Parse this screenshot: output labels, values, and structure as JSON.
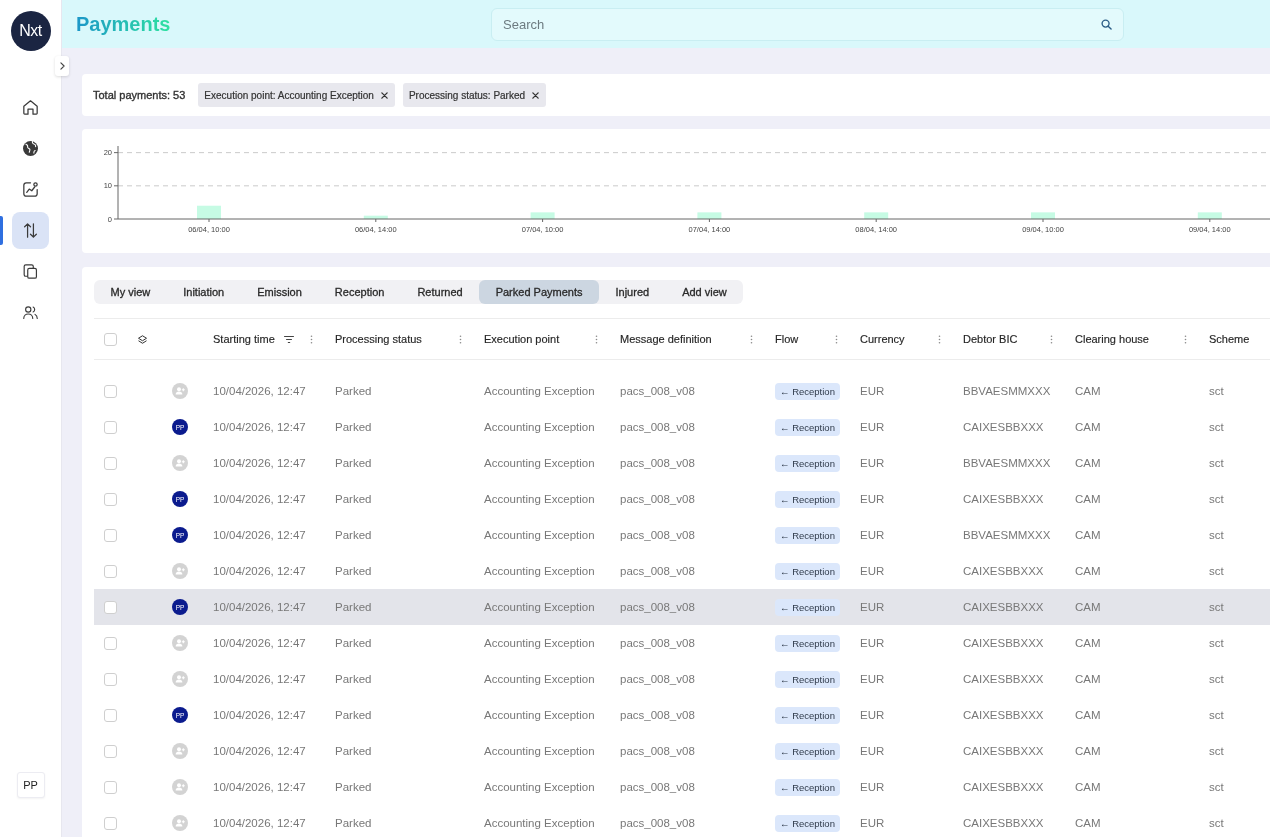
{
  "sidebar": {
    "logo": "Nxt",
    "items": [
      {
        "selected": false
      },
      {
        "selected": false
      },
      {
        "selected": false
      },
      {
        "selected": true
      },
      {
        "selected": false
      },
      {
        "selected": false
      }
    ],
    "user": "PP"
  },
  "top_bar": {
    "title": "Payments",
    "search": {
      "placeholder": "Search"
    }
  },
  "filters": {
    "total": "Total payments: 53",
    "chips": [
      {
        "label": "Execution point: Accounting Exception"
      },
      {
        "label": "Processing status: Parked"
      }
    ]
  },
  "chart": {
    "chart_data": {
      "type": "bar",
      "categories": [
        "06/04, 10:00",
        "06/04, 14:00",
        "07/04, 10:00",
        "07/04, 14:00",
        "08/04, 14:00",
        "09/04, 10:00",
        "09/04, 14:00"
      ],
      "values": [
        4,
        1,
        2,
        2,
        2,
        2,
        2
      ],
      "ylim": [
        0,
        22
      ],
      "yticks": [
        0,
        10,
        20
      ]
    }
  },
  "views": {
    "tabs": [
      {
        "label": "My view",
        "selected": false
      },
      {
        "label": "Initiation",
        "selected": false
      },
      {
        "label": "Emission",
        "selected": false
      },
      {
        "label": "Reception",
        "selected": false
      },
      {
        "label": "Returned",
        "selected": false
      },
      {
        "label": "Parked Payments",
        "selected": true
      },
      {
        "label": "Injured",
        "selected": false
      },
      {
        "label": "Add view",
        "selected": false
      }
    ]
  },
  "table": {
    "select_all": {
      "checked": false
    },
    "columns": [
      {
        "label": "Starting time",
        "filter": true,
        "menu": true
      },
      {
        "label": "Processing status",
        "filter": false,
        "menu": true
      },
      {
        "label": "Execution point",
        "filter": false,
        "menu": true
      },
      {
        "label": "Message definition",
        "filter": false,
        "menu": true
      },
      {
        "label": "Flow",
        "filter": false,
        "menu": true
      },
      {
        "label": "Currency",
        "filter": false,
        "menu": true
      },
      {
        "label": "Debtor BIC",
        "filter": false,
        "menu": true
      },
      {
        "label": "Clearing house",
        "filter": false,
        "menu": true
      },
      {
        "label": "Scheme",
        "filter": false,
        "menu": false
      }
    ],
    "rows": [
      {
        "checked": false,
        "hovered": false,
        "assignee": {
          "kind": "unassigned"
        },
        "starting_time": "10/04/2026, 12:47",
        "processing_status": "Parked",
        "execution_point": "Accounting Exception",
        "message_definition": "pacs_008_v08",
        "flow": "← Reception",
        "currency": "EUR",
        "debtor_bic": "BBVAESMMXXX",
        "clearing_house": "CAM",
        "scheme": "sct"
      },
      {
        "checked": false,
        "hovered": false,
        "assignee": {
          "kind": "initials",
          "initials": "PP"
        },
        "starting_time": "10/04/2026, 12:47",
        "processing_status": "Parked",
        "execution_point": "Accounting Exception",
        "message_definition": "pacs_008_v08",
        "flow": "← Reception",
        "currency": "EUR",
        "debtor_bic": "CAIXESBBXXX",
        "clearing_house": "CAM",
        "scheme": "sct"
      },
      {
        "checked": false,
        "hovered": false,
        "assignee": {
          "kind": "unassigned"
        },
        "starting_time": "10/04/2026, 12:47",
        "processing_status": "Parked",
        "execution_point": "Accounting Exception",
        "message_definition": "pacs_008_v08",
        "flow": "← Reception",
        "currency": "EUR",
        "debtor_bic": "BBVAESMMXXX",
        "clearing_house": "CAM",
        "scheme": "sct"
      },
      {
        "checked": false,
        "hovered": false,
        "assignee": {
          "kind": "initials",
          "initials": "PP"
        },
        "starting_time": "10/04/2026, 12:47",
        "processing_status": "Parked",
        "execution_point": "Accounting Exception",
        "message_definition": "pacs_008_v08",
        "flow": "← Reception",
        "currency": "EUR",
        "debtor_bic": "CAIXESBBXXX",
        "clearing_house": "CAM",
        "scheme": "sct"
      },
      {
        "checked": false,
        "hovered": false,
        "assignee": {
          "kind": "initials",
          "initials": "PP"
        },
        "starting_time": "10/04/2026, 12:47",
        "processing_status": "Parked",
        "execution_point": "Accounting Exception",
        "message_definition": "pacs_008_v08",
        "flow": "← Reception",
        "currency": "EUR",
        "debtor_bic": "BBVAESMMXXX",
        "clearing_house": "CAM",
        "scheme": "sct"
      },
      {
        "checked": false,
        "hovered": false,
        "assignee": {
          "kind": "unassigned"
        },
        "starting_time": "10/04/2026, 12:47",
        "processing_status": "Parked",
        "execution_point": "Accounting Exception",
        "message_definition": "pacs_008_v08",
        "flow": "← Reception",
        "currency": "EUR",
        "debtor_bic": "CAIXESBBXXX",
        "clearing_house": "CAM",
        "scheme": "sct"
      },
      {
        "checked": false,
        "hovered": true,
        "assignee": {
          "kind": "initials",
          "initials": "PP"
        },
        "starting_time": "10/04/2026, 12:47",
        "processing_status": "Parked",
        "execution_point": "Accounting Exception",
        "message_definition": "pacs_008_v08",
        "flow": "← Reception",
        "currency": "EUR",
        "debtor_bic": "CAIXESBBXXX",
        "clearing_house": "CAM",
        "scheme": "sct"
      },
      {
        "checked": false,
        "hovered": false,
        "assignee": {
          "kind": "unassigned"
        },
        "starting_time": "10/04/2026, 12:47",
        "processing_status": "Parked",
        "execution_point": "Accounting Exception",
        "message_definition": "pacs_008_v08",
        "flow": "← Reception",
        "currency": "EUR",
        "debtor_bic": "CAIXESBBXXX",
        "clearing_house": "CAM",
        "scheme": "sct"
      },
      {
        "checked": false,
        "hovered": false,
        "assignee": {
          "kind": "unassigned"
        },
        "starting_time": "10/04/2026, 12:47",
        "processing_status": "Parked",
        "execution_point": "Accounting Exception",
        "message_definition": "pacs_008_v08",
        "flow": "← Reception",
        "currency": "EUR",
        "debtor_bic": "CAIXESBBXXX",
        "clearing_house": "CAM",
        "scheme": "sct"
      },
      {
        "checked": false,
        "hovered": false,
        "assignee": {
          "kind": "initials",
          "initials": "PP"
        },
        "starting_time": "10/04/2026, 12:47",
        "processing_status": "Parked",
        "execution_point": "Accounting Exception",
        "message_definition": "pacs_008_v08",
        "flow": "← Reception",
        "currency": "EUR",
        "debtor_bic": "CAIXESBBXXX",
        "clearing_house": "CAM",
        "scheme": "sct"
      },
      {
        "checked": false,
        "hovered": false,
        "assignee": {
          "kind": "unassigned"
        },
        "starting_time": "10/04/2026, 12:47",
        "processing_status": "Parked",
        "execution_point": "Accounting Exception",
        "message_definition": "pacs_008_v08",
        "flow": "← Reception",
        "currency": "EUR",
        "debtor_bic": "CAIXESBBXXX",
        "clearing_house": "CAM",
        "scheme": "sct"
      },
      {
        "checked": false,
        "hovered": false,
        "assignee": {
          "kind": "unassigned"
        },
        "starting_time": "10/04/2026, 12:47",
        "processing_status": "Parked",
        "execution_point": "Accounting Exception",
        "message_definition": "pacs_008_v08",
        "flow": "← Reception",
        "currency": "EUR",
        "debtor_bic": "CAIXESBBXXX",
        "clearing_house": "CAM",
        "scheme": "sct"
      },
      {
        "checked": false,
        "hovered": false,
        "assignee": {
          "kind": "unassigned"
        },
        "starting_time": "10/04/2026, 12:47",
        "processing_status": "Parked",
        "execution_point": "Accounting Exception",
        "message_definition": "pacs_008_v08",
        "flow": "← Reception",
        "currency": "EUR",
        "debtor_bic": "CAIXESBBXXX",
        "clearing_house": "CAM",
        "scheme": "sct"
      }
    ]
  }
}
